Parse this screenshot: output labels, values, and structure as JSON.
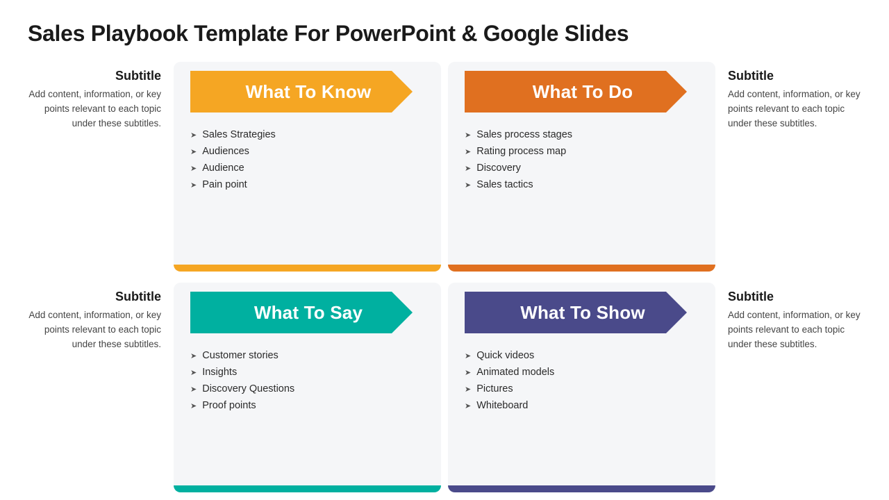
{
  "page": {
    "title": "Sales Playbook Template For PowerPoint & Google Slides"
  },
  "subtitles": {
    "left_top": {
      "heading": "Subtitle",
      "body": "Add content, information, or key points relevant to each topic under these subtitles."
    },
    "right_top": {
      "heading": "Subtitle",
      "body": "Add content, information, or key points relevant to each topic under these subtitles."
    },
    "left_bottom": {
      "heading": "Subtitle",
      "body": "Add content, information, or key points relevant to each topic under these subtitles."
    },
    "right_bottom": {
      "heading": "Subtitle",
      "body": "Add content, information, or key points relevant to each topic under these subtitles."
    }
  },
  "cards": {
    "know": {
      "title": "What To Know",
      "items": [
        "Sales Strategies",
        "Audiences",
        "Audience",
        "Pain point"
      ]
    },
    "do": {
      "title": "What To Do",
      "items": [
        "Sales process stages",
        "Rating process map",
        "Discovery",
        "Sales tactics"
      ]
    },
    "say": {
      "title": "What To Say",
      "items": [
        "Customer stories",
        "Insights",
        "Discovery Questions",
        "Proof points"
      ]
    },
    "show": {
      "title": "What To Show",
      "items": [
        "Quick videos",
        "Animated models",
        "Pictures",
        "Whiteboard"
      ]
    }
  }
}
